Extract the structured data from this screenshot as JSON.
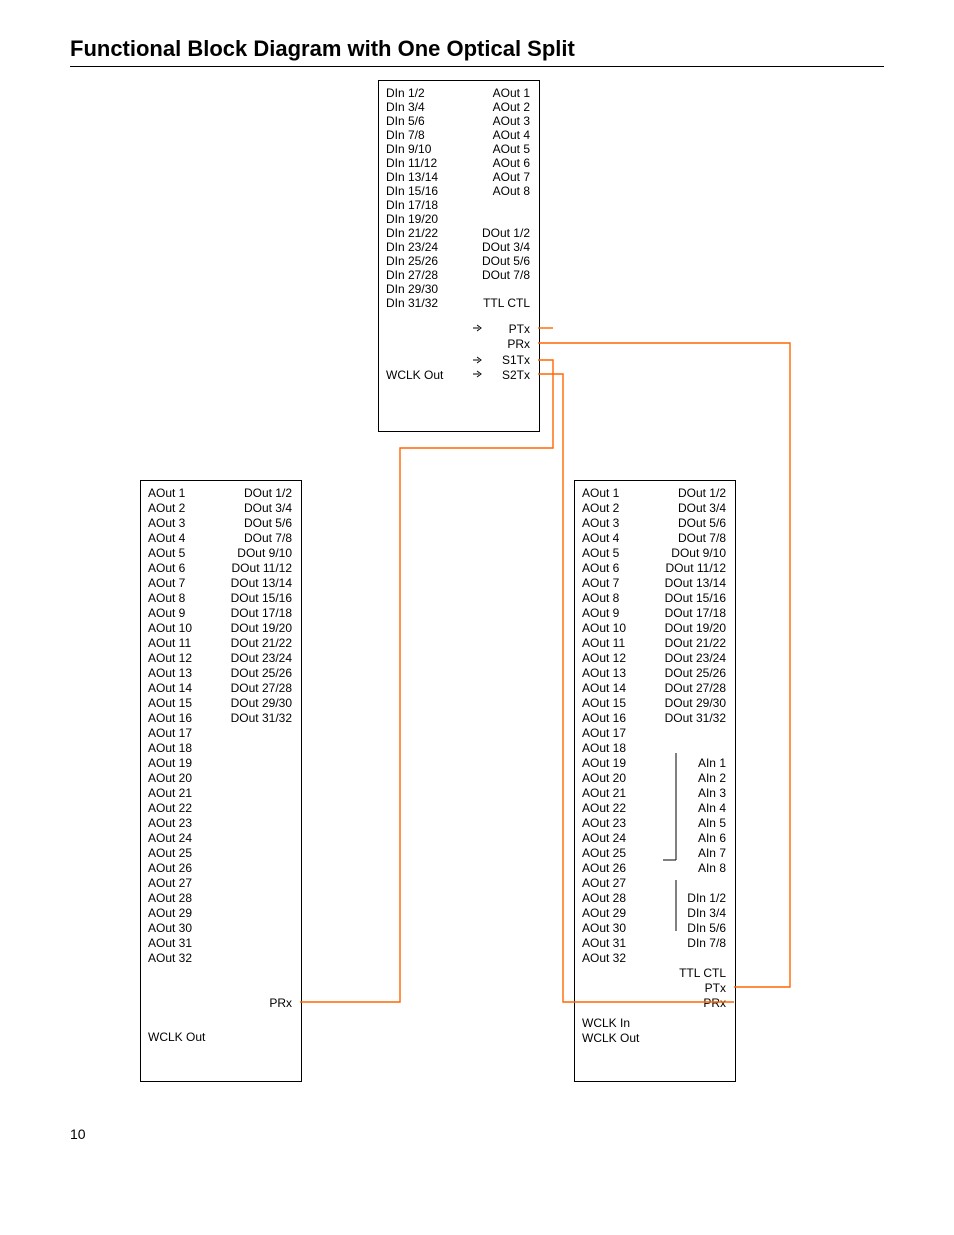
{
  "title": "Functional Block Diagram with One Optical Split",
  "page_number": "10",
  "top_block": {
    "left_col": [
      "DIn 1/2",
      "DIn 3/4",
      "DIn 5/6",
      "DIn 7/8",
      "DIn 9/10",
      "DIn 11/12",
      "DIn 13/14",
      "DIn 15/16",
      "DIn 17/18",
      "DIn 19/20",
      "DIn 21/22",
      "DIn 23/24",
      "DIn 25/26",
      "DIn 27/28",
      "DIn 29/30",
      "DIn 31/32"
    ],
    "wclk": "WCLK Out",
    "right_col_a": [
      "AOut 1",
      "AOut 2",
      "AOut 3",
      "AOut 4",
      "AOut 5",
      "AOut 6",
      "AOut 7",
      "AOut 8"
    ],
    "right_col_b": [
      "DOut 1/2",
      "DOut 3/4",
      "DOut 5/6",
      "DOut 7/8"
    ],
    "ttl": "TTL CTL",
    "ptx": "PTx",
    "prx": "PRx",
    "s1tx": "S1Tx",
    "s2tx": "S2Tx"
  },
  "left_block": {
    "aout": [
      "AOut 1",
      "AOut 2",
      "AOut 3",
      "AOut 4",
      "AOut 5",
      "AOut 6",
      "AOut 7",
      "AOut 8",
      "AOut 9",
      "AOut 10",
      "AOut 11",
      "AOut 12",
      "AOut 13",
      "AOut 14",
      "AOut 15",
      "AOut 16",
      "AOut 17",
      "AOut 18",
      "AOut 19",
      "AOut 20",
      "AOut 21",
      "AOut 22",
      "AOut 23",
      "AOut 24",
      "AOut 25",
      "AOut 26",
      "AOut 27",
      "AOut 28",
      "AOut 29",
      "AOut 30",
      "AOut 31",
      "AOut 32"
    ],
    "dout": [
      "DOut 1/2",
      "DOut 3/4",
      "DOut 5/6",
      "DOut 7/8",
      "DOut 9/10",
      "DOut 11/12",
      "DOut 13/14",
      "DOut 15/16",
      "DOut 17/18",
      "DOut 19/20",
      "DOut 21/22",
      "DOut 23/24",
      "DOut 25/26",
      "DOut 27/28",
      "DOut 29/30",
      "DOut 31/32"
    ],
    "prx": "PRx",
    "wclk": "WCLK Out"
  },
  "right_block": {
    "aout": [
      "AOut 1",
      "AOut 2",
      "AOut 3",
      "AOut 4",
      "AOut 5",
      "AOut 6",
      "AOut 7",
      "AOut 8",
      "AOut 9",
      "AOut 10",
      "AOut 11",
      "AOut 12",
      "AOut 13",
      "AOut 14",
      "AOut 15",
      "AOut 16",
      "AOut 17",
      "AOut 18",
      "AOut 19",
      "AOut 20",
      "AOut 21",
      "AOut 22",
      "AOut 23",
      "AOut 24",
      "AOut 25",
      "AOut 26",
      "AOut 27",
      "AOut 28",
      "AOut 29",
      "AOut 30",
      "AOut 31",
      "AOut 32"
    ],
    "dout": [
      "DOut 1/2",
      "DOut 3/4",
      "DOut 5/6",
      "DOut 7/8",
      "DOut 9/10",
      "DOut 11/12",
      "DOut 13/14",
      "DOut 15/16",
      "DOut 17/18",
      "DOut 19/20",
      "DOut 21/22",
      "DOut 23/24",
      "DOut 25/26",
      "DOut 27/28",
      "DOut 29/30",
      "DOut 31/32"
    ],
    "ain": [
      "AIn 1",
      "AIn 2",
      "AIn 3",
      "AIn 4",
      "AIn 5",
      "AIn 6",
      "AIn 7",
      "AIn 8"
    ],
    "din": [
      "DIn 1/2",
      "DIn 3/4",
      "DIn 5/6",
      "DIn 7/8"
    ],
    "ttl": "TTL CTL",
    "ptx": "PTx",
    "prx": "PRx",
    "wclk_in": "WCLK In",
    "wclk_out": "WCLK Out"
  },
  "chart_data": {
    "type": "block-diagram",
    "description": "Three functional blocks connected by optical fiber lines (orange). The top block is a transmitter/receiver hub with DIn, AOut, DOut, TTL CTL, PTx/PRx and S1Tx/S2Tx optical ports. Two lower blocks (left and right) are receivers with AOut 1-32 and DOut 1/2-31/32 outputs. S1Tx from the top block connects to PRx of the left block; S2Tx connects to PRx of the right block; PTx of the right block connects back to PRx of the top block."
  }
}
